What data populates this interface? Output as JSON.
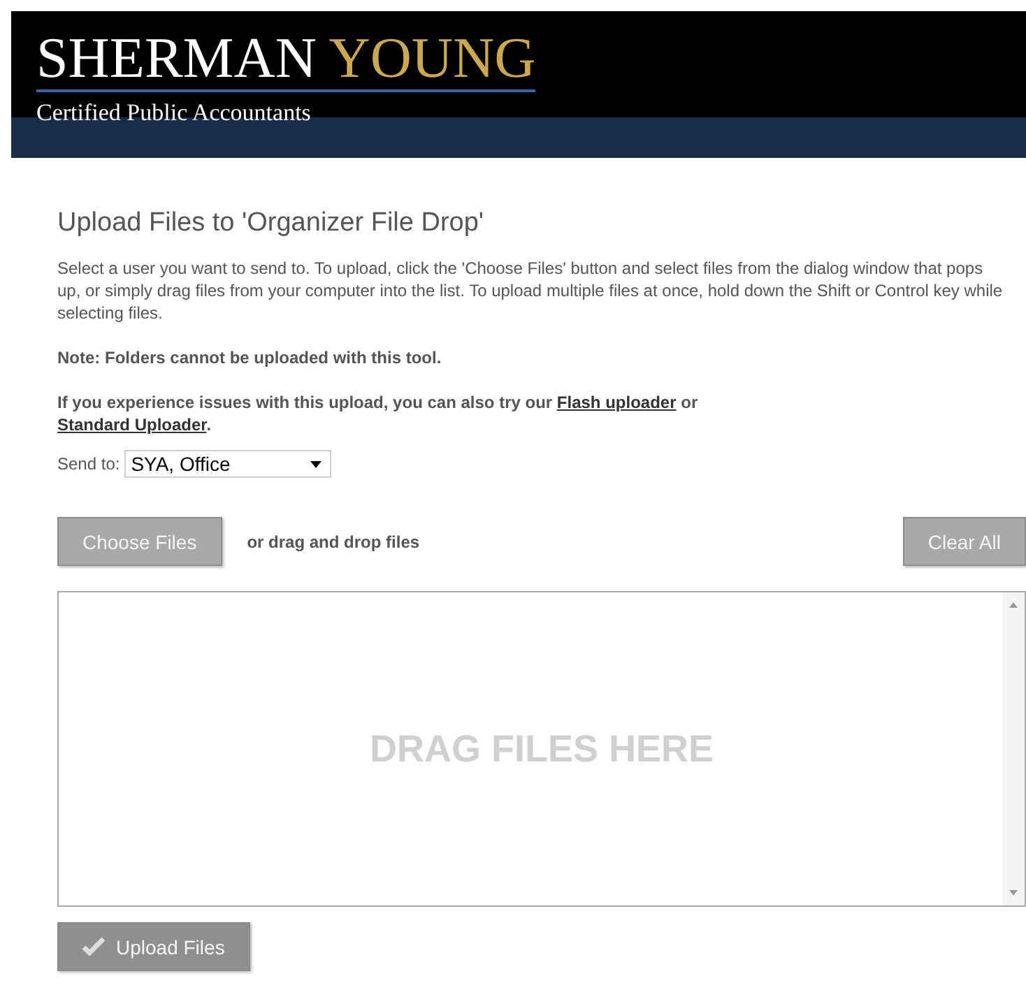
{
  "header": {
    "logo_primary": "SHERMAN",
    "logo_accent": "YOUNG",
    "tagline": "Certified Public Accountants"
  },
  "title": "Upload Files to 'Organizer File Drop'",
  "instructions": "Select a user you want to send to. To upload, click the 'Choose Files' button and select files from the dialog window that pops up, or simply drag files from your computer into the list. To upload multiple files at once, hold down the Shift or Control key while selecting files.",
  "note": "Note: Folders cannot be uploaded with this tool.",
  "alternatives": [
    {
      "kind": "text",
      "text": "If you experience issues with this upload, you can also try our "
    },
    {
      "kind": "link",
      "text": "Flash uploader"
    },
    {
      "kind": "text",
      "text": " or"
    },
    {
      "kind": "break"
    },
    {
      "kind": "link",
      "text": "Standard Uploader"
    },
    {
      "kind": "text",
      "text": "."
    }
  ],
  "send_to": {
    "label": "Send to:",
    "value": "SYA, Office"
  },
  "choose_button": "Choose Files",
  "drag_hint": "or drag and drop files",
  "clear_button": "Clear All",
  "drop_zone": {
    "prompt": "DRAG FILES HERE"
  },
  "upload_button": "Upload Files"
}
